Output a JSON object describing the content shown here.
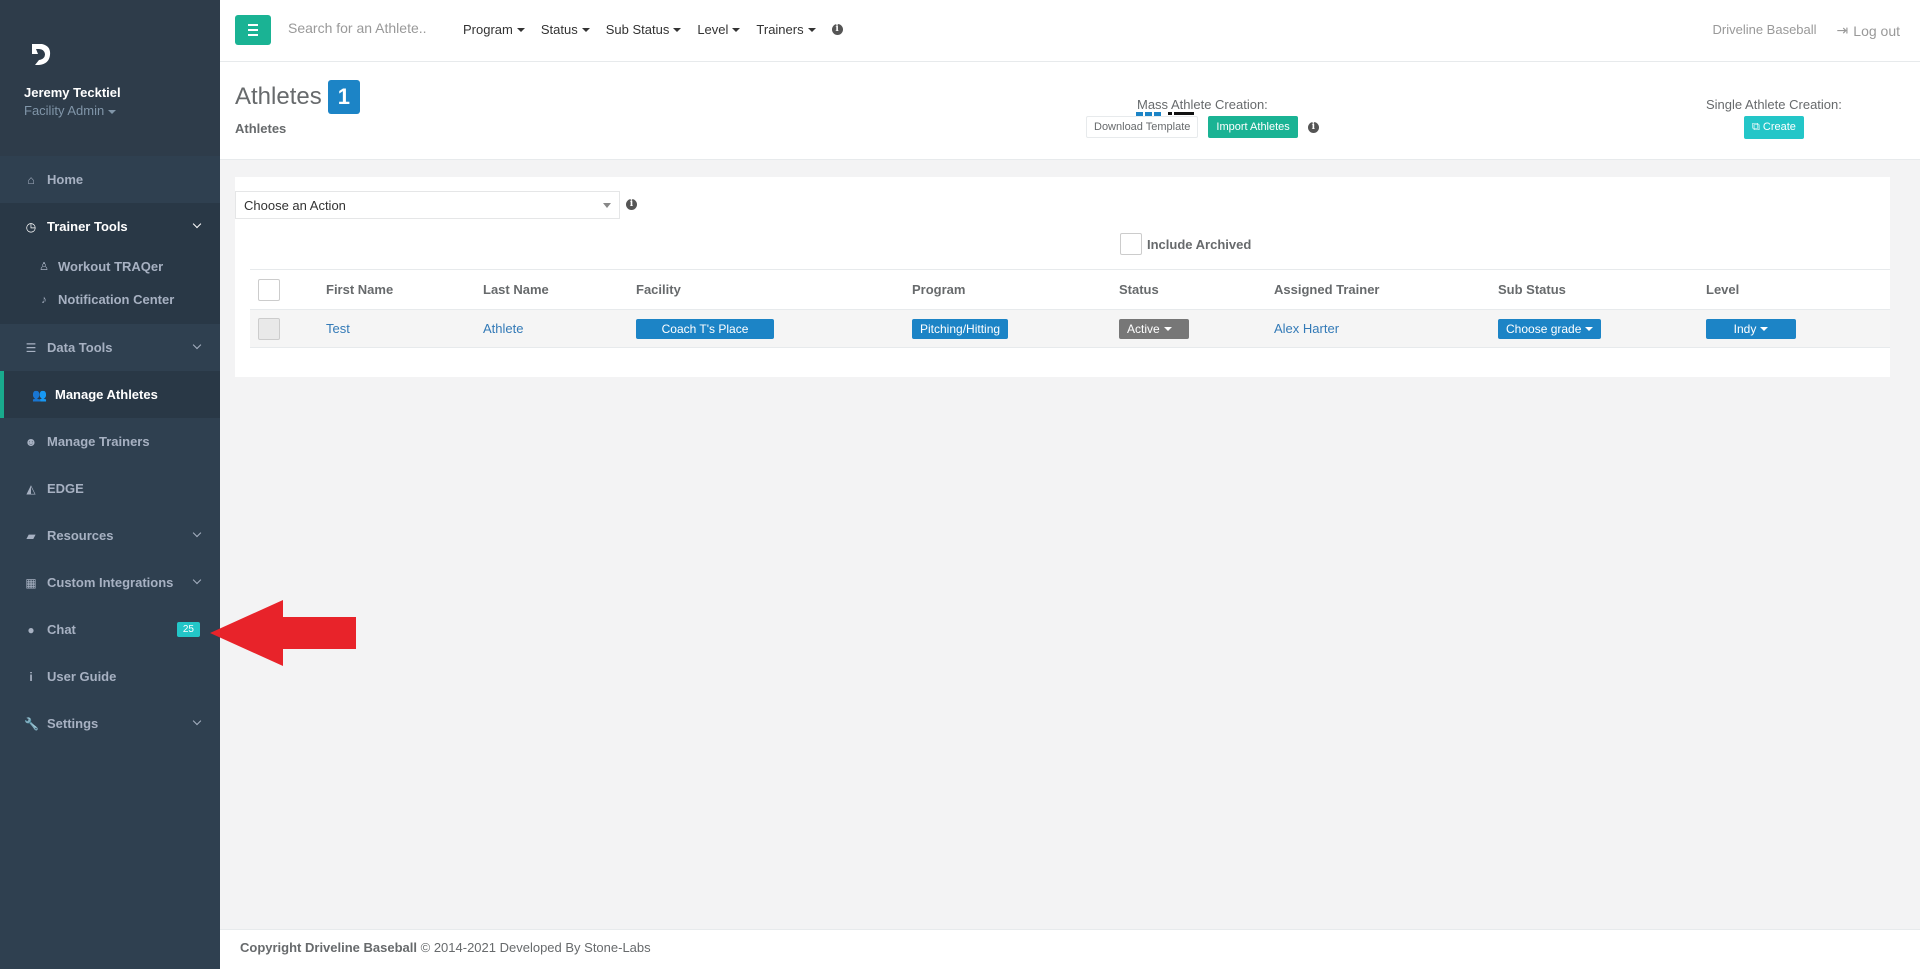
{
  "sidebar": {
    "user_name": "Jeremy Tecktiel",
    "user_role": "Facility Admin",
    "items": [
      {
        "label": "Home",
        "icon": "home-icon"
      },
      {
        "label": "Trainer Tools",
        "icon": "clock-icon"
      },
      {
        "label": "Data Tools",
        "icon": "list-icon"
      },
      {
        "label": "Manage Athletes",
        "icon": "users-icon"
      },
      {
        "label": "Manage Trainers",
        "icon": "user-plus-icon"
      },
      {
        "label": "EDGE",
        "icon": "area-chart-icon"
      },
      {
        "label": "Resources",
        "icon": "book-icon"
      },
      {
        "label": "Custom Integrations",
        "icon": "grid-icon"
      },
      {
        "label": "Chat",
        "icon": "comment-icon",
        "badge": "25"
      },
      {
        "label": "User Guide",
        "icon": "info-icon"
      },
      {
        "label": "Settings",
        "icon": "wrench-icon"
      }
    ],
    "sub_items": [
      {
        "label": "Workout TRAQer",
        "icon": "male-icon"
      },
      {
        "label": "Notification Center",
        "icon": "bell-icon"
      }
    ]
  },
  "topbar": {
    "search_placeholder": "Search for an Athlete..",
    "filters": [
      "Program",
      "Status",
      "Sub Status",
      "Level",
      "Trainers"
    ],
    "org_name": "Driveline Baseball",
    "logout_label": "Log out"
  },
  "heading": {
    "title": "Athletes",
    "count": "1",
    "subtitle": "Athletes",
    "mass_label": "Mass Athlete Creation:",
    "download_template": "Download Template",
    "import_athletes": "Import Athletes",
    "single_label": "Single Athlete Creation:",
    "create_label": "Create"
  },
  "content": {
    "action_select": "Choose an Action",
    "include_archived": "Include Archived",
    "columns": [
      "First Name",
      "Last Name",
      "Facility",
      "Program",
      "Status",
      "Assigned Trainer",
      "Sub Status",
      "Level"
    ],
    "rows": [
      {
        "first_name": "Test",
        "last_name": "Athlete",
        "facility": "Coach T's Place",
        "program": "Pitching/Hitting",
        "status": "Active",
        "trainer": "Alex Harter",
        "sub_status": "Choose grade",
        "level": "Indy"
      }
    ]
  },
  "footer": {
    "copyright_bold": "Copyright Driveline Baseball",
    "copyright_rest": "© 2014-2021 Developed By Stone-Labs"
  },
  "colors": {
    "sidebar_bg": "#2f4050",
    "accent_green": "#1ab394",
    "primary_blue": "#1c84c6",
    "cyan": "#23c6c8",
    "annotation_red": "#e8232a"
  }
}
